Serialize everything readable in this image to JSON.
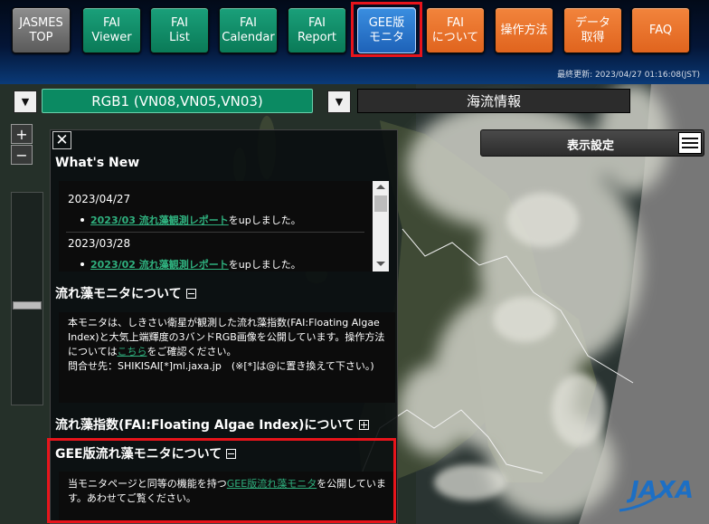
{
  "nav": {
    "buttons": [
      {
        "label": "JASMES\nTOP",
        "style": "gray"
      },
      {
        "label": "FAI\nViewer",
        "style": "green"
      },
      {
        "label": "FAI\nList",
        "style": "green"
      },
      {
        "label": "FAI\nCalendar",
        "style": "green"
      },
      {
        "label": "FAI\nReport",
        "style": "green"
      },
      {
        "label": "GEE版\nモニタ",
        "style": "blue"
      },
      {
        "label": "FAI\nについて",
        "style": "orange"
      },
      {
        "label": "操作方法",
        "style": "orange"
      },
      {
        "label": "データ\n取得",
        "style": "orange"
      },
      {
        "label": "FAQ",
        "style": "orange"
      }
    ],
    "active": "GEE版\nモニタ"
  },
  "last_updated": "最終更新: 2023/04/27 01:16:08(JST)",
  "selectors": {
    "rgb": "RGB1 (VN08,VN05,VN03)",
    "layer": "海流情報"
  },
  "zoom": {
    "in": "+",
    "out": "−"
  },
  "display_settings": "表示設定",
  "panel": {
    "close": "✕",
    "whats_new_title": "What's New",
    "news": [
      {
        "date": "2023/04/27",
        "link": "2023/03 流れ藻観測レポート",
        "suffix": "をupしました。"
      },
      {
        "date": "2023/03/28",
        "link": "2023/02 流れ藻観測レポート",
        "suffix": "をupしました。"
      }
    ],
    "monitor_title": "流れ藻モニタについて",
    "monitor_text_1": "本モニタは、しきさい衛星が観測した流れ藻指数(FAI:Floating Algae Index)と大気上端輝度の3バンドRGB画像を公開しています。操作方法については",
    "monitor_link": "こちら",
    "monitor_text_2": "をご確認ください。",
    "monitor_contact": "問合せ先：SHIKISAI[*]ml.jaxa.jp　(※[*]は@に置き換えて下さい。)",
    "fai_title": "流れ藻指数(FAI:Floating Algae Index)について",
    "gee_title": "GEE版流れ藻モニタについて",
    "gee_text_1": "当モニタページと同等の機能を持つ",
    "gee_link": "GEE版流れ藻モニタ",
    "gee_text_2": "を公開しています。あわせてご覧ください。"
  },
  "logo": "JAXA",
  "colors": {
    "accent_red": "#e8141b",
    "link_green": "#2fb07e",
    "nav_green": "#0a7a57",
    "nav_orange": "#e0641e",
    "nav_blue": "#1e62b8"
  }
}
